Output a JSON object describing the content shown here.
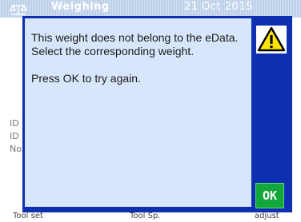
{
  "background": {
    "title": "Weighing",
    "date": "21 Oct 2015",
    "side_labels": [
      "ID",
      "ID",
      "No"
    ],
    "bottom_labels": [
      "Tool set",
      "Tool Sp.",
      "adjust"
    ]
  },
  "dialog": {
    "message_line1": "This weight does not belong to the eData. Select the corresponding weight.",
    "message_line2": "Press OK to try again.",
    "icon": "warning-icon",
    "ok_label": "OK"
  },
  "colors": {
    "dialog_frame": "#0d2fb0",
    "dialog_body": "#d8e6fb",
    "ok_button": "#14a83c",
    "warning_yellow": "#ffe400"
  }
}
